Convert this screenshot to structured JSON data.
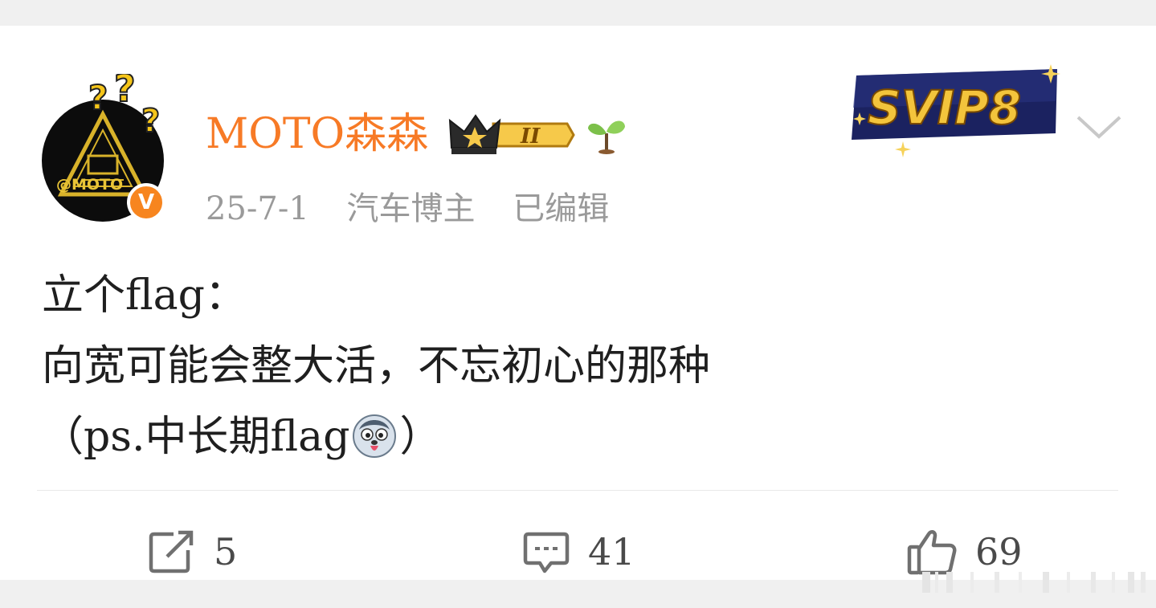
{
  "post": {
    "author": {
      "name": "MOTO森森",
      "level_badge": "II",
      "avatar_text": "@MOTO"
    },
    "meta": {
      "date": "25-7-1",
      "role": "汽车博主",
      "edited": "已编辑"
    },
    "vip": {
      "label": "SVIP8"
    },
    "content": {
      "line1": "立个flag：",
      "line2": "向宽可能会整大活，不忘初心的那种",
      "line3_before": "（ps.中长期flag",
      "line3_after": "）"
    },
    "actions": {
      "repost_count": "5",
      "comment_count": "41",
      "like_count": "69"
    }
  },
  "icons": {
    "verified": "verified-v-icon",
    "crown": "crown-icon",
    "sprout": "sprout-icon",
    "expand": "chevron-down-icon",
    "repost": "repost-icon",
    "comment": "comment-icon",
    "like": "thumbs-up-icon",
    "emoji": "husky-face-emoji"
  },
  "colors": {
    "username": "#f77a26",
    "meta_text": "#9a9a9a",
    "verified": "#f7851f",
    "body_text": "#1f1f1f"
  }
}
